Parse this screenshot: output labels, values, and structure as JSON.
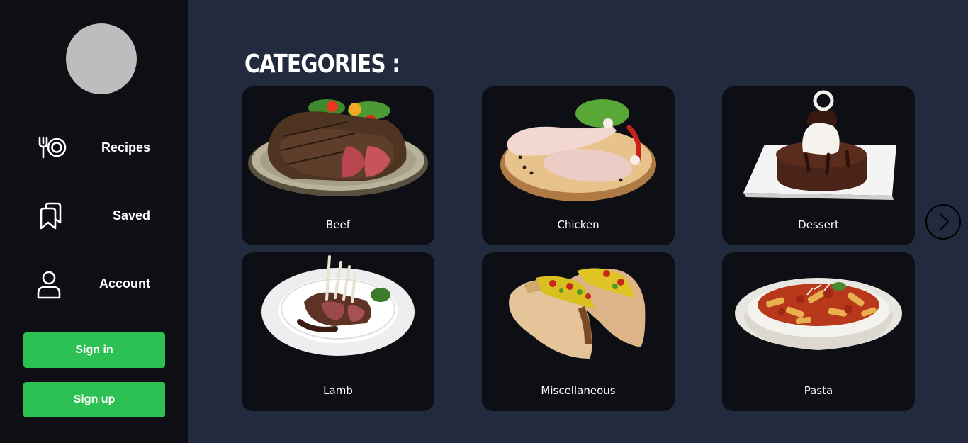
{
  "sidebar": {
    "avatar": "avatar-placeholder",
    "nav": [
      {
        "label": "Recipes",
        "icon": "plate-fork-icon"
      },
      {
        "label": "Saved",
        "icon": "bookmarks-icon"
      },
      {
        "label": "Account",
        "icon": "user-icon"
      }
    ],
    "sign_in_label": "Sign in",
    "sign_up_label": "Sign up"
  },
  "main": {
    "title": "CATEGORIES :",
    "categories": [
      {
        "name": "Beef",
        "image": "steak-plate"
      },
      {
        "name": "Chicken",
        "image": "raw-chicken-legs"
      },
      {
        "name": "Dessert",
        "image": "chocolate-cake"
      },
      {
        "name": "Lamb",
        "image": "lamb-chops"
      },
      {
        "name": "Miscellaneous",
        "image": "tacos"
      },
      {
        "name": "Pasta",
        "image": "penne-bowl"
      }
    ],
    "next_icon": "chevron-right-icon"
  },
  "colors": {
    "background": "#222a3e",
    "sidebar": "#0d0f14",
    "card": "#0d0f14",
    "accent": "#2cc152"
  }
}
